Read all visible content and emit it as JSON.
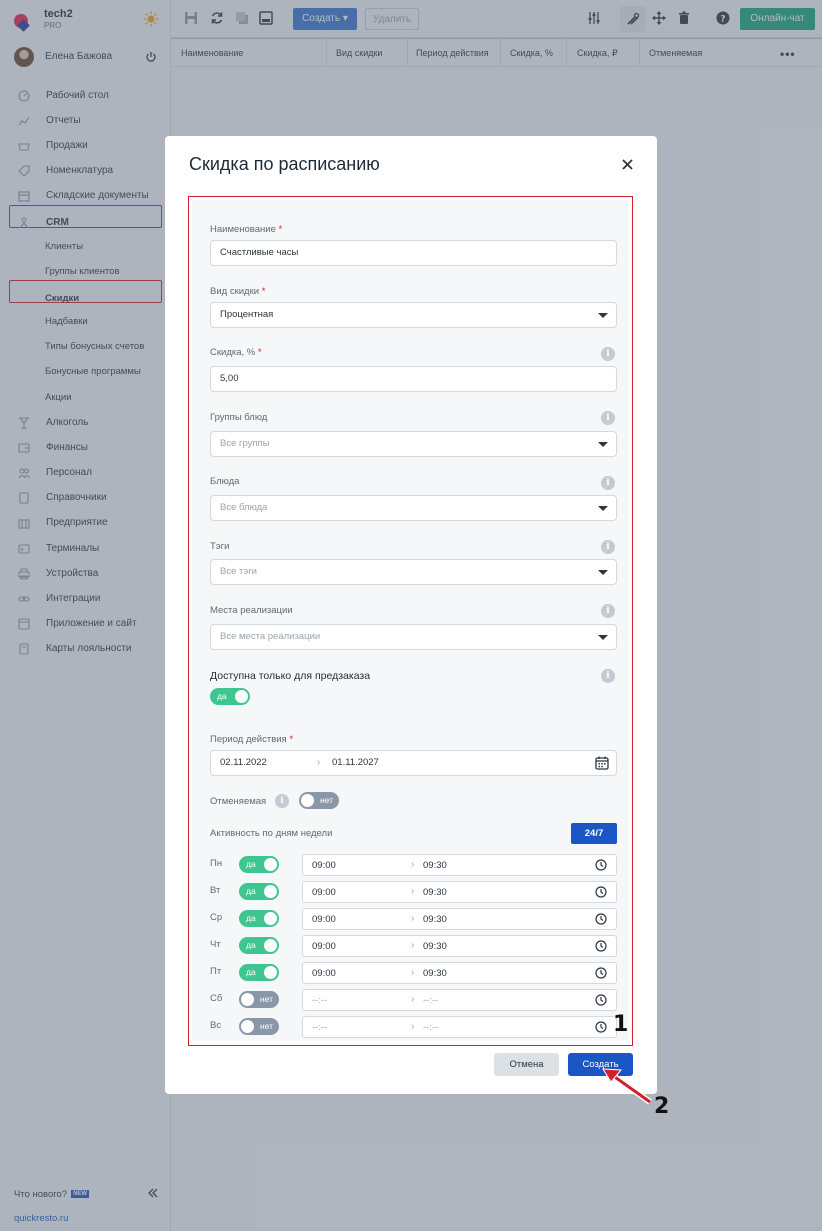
{
  "brand": {
    "name": "tech2",
    "plan": "PRO"
  },
  "user": {
    "name": "Елена Бажова"
  },
  "nav": [
    {
      "label": "Рабочий стол",
      "icon": "dashboard-icon"
    },
    {
      "label": "Отчеты",
      "icon": "chart-icon"
    },
    {
      "label": "Продажи",
      "icon": "basket-icon"
    },
    {
      "label": "Номенклатура",
      "icon": "tag-icon"
    },
    {
      "label": "Складские документы",
      "icon": "box-icon"
    },
    {
      "label": "CRM",
      "icon": "crm-icon",
      "highlighted": true
    },
    {
      "label": "Клиенты",
      "sub": true
    },
    {
      "label": "Группы клиентов",
      "sub": true
    },
    {
      "label": "Скидки",
      "sub": true,
      "highlighted": true
    },
    {
      "label": "Надбавки",
      "sub": true
    },
    {
      "label": "Типы бонусных счетов",
      "sub": true
    },
    {
      "label": "Бонусные программы",
      "sub": true
    },
    {
      "label": "Акции",
      "sub": true
    },
    {
      "label": "Алкоголь",
      "icon": "glass-icon"
    },
    {
      "label": "Финансы",
      "icon": "wallet-icon"
    },
    {
      "label": "Персонал",
      "icon": "people-icon"
    },
    {
      "label": "Справочники",
      "icon": "book-icon"
    },
    {
      "label": "Предприятие",
      "icon": "building-icon"
    },
    {
      "label": "Терминалы",
      "icon": "terminal-icon"
    },
    {
      "label": "Устройства",
      "icon": "printer-icon"
    },
    {
      "label": "Интеграции",
      "icon": "link-icon"
    },
    {
      "label": "Приложение и сайт",
      "icon": "app-icon"
    },
    {
      "label": "Карты лояльности",
      "icon": "card-icon"
    }
  ],
  "sidebar_bottom": {
    "whats_new": "Что нового?",
    "badge": "NEW",
    "site": "quickresto.ru"
  },
  "toolbar": {
    "create": "Создать",
    "delete": "Удалить",
    "online_chat": "Онлайн-чат"
  },
  "table_headers": [
    "Наименование",
    "Вид скидки",
    "Период действия",
    "Скидка, %",
    "Скидка, ₽",
    "Отменяемая"
  ],
  "modal": {
    "title": "Скидка по расписанию",
    "name": {
      "label": "Наименование",
      "value": "Счастливые часы"
    },
    "discount_type": {
      "label": "Вид скидки",
      "value": "Процентная"
    },
    "discount_pct": {
      "label": "Скидка, %",
      "value": "5,00"
    },
    "dish_groups": {
      "label": "Группы блюд",
      "placeholder": "Все группы"
    },
    "dishes": {
      "label": "Блюда",
      "placeholder": "Все блюда"
    },
    "tags": {
      "label": "Тэги",
      "placeholder": "Все тэги"
    },
    "places": {
      "label": "Места реализации",
      "placeholder": "Все места реализации"
    },
    "preorder": {
      "label": "Доступна только для предзаказа",
      "toggle": "да",
      "on": true
    },
    "period": {
      "label": "Период действия",
      "from": "02.11.2022",
      "to": "01.11.2027"
    },
    "cancelable": {
      "label": "Отменяемая",
      "toggle": "нет",
      "on": false
    },
    "weekly": {
      "label": "Активность по дням недели",
      "btn_247": "24/7",
      "days": [
        {
          "day": "Пн",
          "toggle": "да",
          "on": true,
          "from": "09:00",
          "to": "09:30"
        },
        {
          "day": "Вт",
          "toggle": "да",
          "on": true,
          "from": "09:00",
          "to": "09:30"
        },
        {
          "day": "Ср",
          "toggle": "да",
          "on": true,
          "from": "09:00",
          "to": "09:30"
        },
        {
          "day": "Чт",
          "toggle": "да",
          "on": true,
          "from": "09:00",
          "to": "09:30"
        },
        {
          "day": "Пт",
          "toggle": "да",
          "on": true,
          "from": "09:00",
          "to": "09:30"
        },
        {
          "day": "Сб",
          "toggle": "нет",
          "on": false,
          "from": "--:--",
          "to": "--:--"
        },
        {
          "day": "Вс",
          "toggle": "нет",
          "on": false,
          "from": "--:--",
          "to": "--:--"
        }
      ]
    },
    "buttons": {
      "cancel": "Отмена",
      "create": "Создать"
    }
  },
  "annotations": {
    "one": "1",
    "two": "2"
  },
  "colors": {
    "accent": "#1a56c4",
    "toggle_on": "#3fc690",
    "toggle_off": "#8a97a8",
    "highlight": "#d0202a",
    "online_chat": "#15a67a"
  }
}
